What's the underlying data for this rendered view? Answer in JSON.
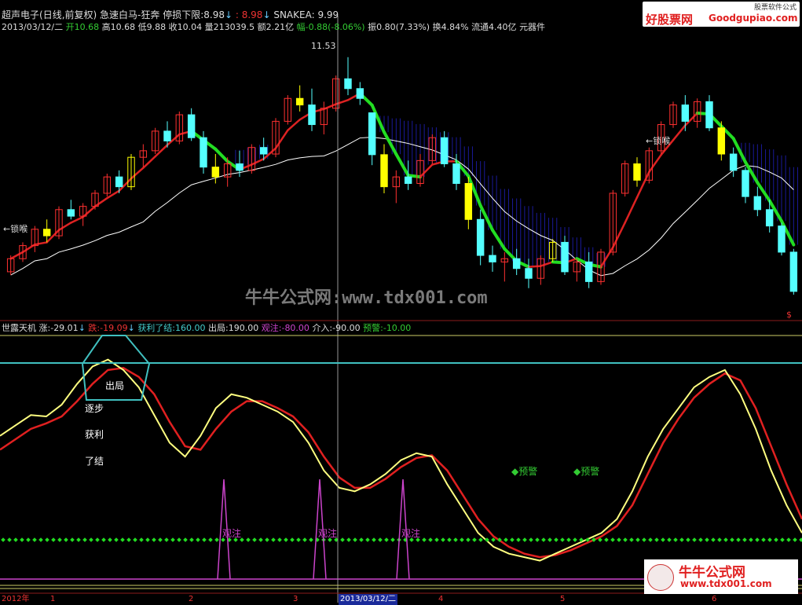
{
  "header": {
    "stock_name": "超声电子",
    "mode": "(日线,前复权)",
    "formula": "急速白马-狂奔",
    "stoploss_label": "停损下限:",
    "stoploss_value": "8.98",
    "stoploss_value2": ": 8.98",
    "snakea_label": "SNAKEA:",
    "snakea_value": "9.99",
    "date": "2013/03/12/二",
    "open": "开10.68",
    "high": "高10.68",
    "low": "低9.88",
    "close": "收10.04",
    "volume": "量213039.5",
    "amount": "额2.21亿",
    "change": "幅-0.88(-8.06%)",
    "amplitude": "振0.80(7.33%)",
    "turnover": "换4.84%",
    "float": "流通4.40亿",
    "sector": "元器件"
  },
  "logo": {
    "site_cn": "好股票网",
    "site_en": "Goodgupiao.com",
    "tag": "股票软件公式"
  },
  "watermark": {
    "center": "牛牛公式网:www.tdx001.com",
    "corner_cn": "牛牛公式网",
    "corner_url": "www.tdx001.com"
  },
  "indicator": {
    "name": "世露天机",
    "zhang_label": "涨:",
    "zhang_value": "-29.01",
    "die_label": "跌:",
    "die_value": "-19.09",
    "profit_label": "获利了结:",
    "profit_value": "160.00",
    "exit_label": "出局:",
    "exit_value": "190.00",
    "watch_label": "观注:",
    "watch_value": "-80.00",
    "enter_label": "介入:",
    "enter_value": "-90.00",
    "warn_label": "预警:",
    "warn_value": "-10.00"
  },
  "annotations": {
    "peak_price": "11.53",
    "lock_throat_left": "←锁喉",
    "lock_throat_right": "←锁喉",
    "exit": "出局",
    "gradual": "逐步",
    "profit": "获利",
    "close_out": "了结",
    "watch": "观注",
    "warning": "预警"
  },
  "xaxis": {
    "labels": [
      "2012年",
      "1",
      "2",
      "3",
      "2013/03/12/二",
      "4",
      "5",
      "6"
    ]
  },
  "colors": {
    "up_candle": "#ff3030",
    "down_candle": "#54ffff",
    "yellow": "#ffff00",
    "green_line": "#22dd22",
    "red_line": "#dd2222",
    "white_line": "#ffffff",
    "cloud": "#1a1a9a",
    "indicator_yellow": "#ffff80",
    "indicator_red": "#e02020",
    "magenta": "#cc44cc",
    "cyan": "#40c0c0"
  },
  "chart_data": {
    "type": "candlestick",
    "price_range": [
      7.6,
      11.9
    ],
    "candles": [
      {
        "o": 8.25,
        "h": 8.5,
        "l": 8.2,
        "c": 8.45
      },
      {
        "o": 8.45,
        "h": 8.7,
        "l": 8.4,
        "c": 8.65
      },
      {
        "o": 8.65,
        "h": 8.95,
        "l": 8.55,
        "c": 8.9
      },
      {
        "o": 8.9,
        "h": 9.05,
        "l": 8.7,
        "c": 8.8
      },
      {
        "o": 8.8,
        "h": 9.25,
        "l": 8.75,
        "c": 9.2
      },
      {
        "o": 9.2,
        "h": 9.35,
        "l": 9.05,
        "c": 9.1
      },
      {
        "o": 9.1,
        "h": 9.3,
        "l": 8.95,
        "c": 9.25
      },
      {
        "o": 9.25,
        "h": 9.5,
        "l": 9.2,
        "c": 9.45
      },
      {
        "o": 9.45,
        "h": 9.75,
        "l": 9.4,
        "c": 9.7
      },
      {
        "o": 9.7,
        "h": 9.8,
        "l": 9.45,
        "c": 9.55
      },
      {
        "o": 9.55,
        "h": 10.05,
        "l": 9.5,
        "c": 10.0
      },
      {
        "o": 10.0,
        "h": 10.2,
        "l": 9.85,
        "c": 10.1
      },
      {
        "o": 10.1,
        "h": 10.45,
        "l": 10.05,
        "c": 10.4
      },
      {
        "o": 10.4,
        "h": 10.55,
        "l": 10.15,
        "c": 10.25
      },
      {
        "o": 10.25,
        "h": 10.7,
        "l": 10.2,
        "c": 10.65
      },
      {
        "o": 10.65,
        "h": 10.75,
        "l": 10.25,
        "c": 10.3
      },
      {
        "o": 10.3,
        "h": 10.4,
        "l": 9.75,
        "c": 9.85
      },
      {
        "o": 9.85,
        "h": 10.05,
        "l": 9.6,
        "c": 9.7
      },
      {
        "o": 9.7,
        "h": 10.0,
        "l": 9.55,
        "c": 9.9
      },
      {
        "o": 9.9,
        "h": 10.1,
        "l": 9.7,
        "c": 9.8
      },
      {
        "o": 9.8,
        "h": 10.2,
        "l": 9.75,
        "c": 10.15
      },
      {
        "o": 10.15,
        "h": 10.3,
        "l": 9.95,
        "c": 10.05
      },
      {
        "o": 10.05,
        "h": 10.6,
        "l": 10.0,
        "c": 10.55
      },
      {
        "o": 10.55,
        "h": 10.95,
        "l": 10.5,
        "c": 10.9
      },
      {
        "o": 10.9,
        "h": 11.1,
        "l": 10.7,
        "c": 10.8
      },
      {
        "o": 10.8,
        "h": 11.05,
        "l": 10.4,
        "c": 10.5
      },
      {
        "o": 10.5,
        "h": 10.85,
        "l": 10.35,
        "c": 10.75
      },
      {
        "o": 10.75,
        "h": 11.25,
        "l": 10.7,
        "c": 11.2
      },
      {
        "o": 11.2,
        "h": 11.53,
        "l": 10.95,
        "c": 11.05
      },
      {
        "o": 11.05,
        "h": 11.15,
        "l": 10.8,
        "c": 10.9
      },
      {
        "o": 10.68,
        "h": 10.68,
        "l": 9.88,
        "c": 10.04
      },
      {
        "o": 10.04,
        "h": 10.2,
        "l": 9.45,
        "c": 9.55
      },
      {
        "o": 9.55,
        "h": 9.8,
        "l": 9.3,
        "c": 9.7
      },
      {
        "o": 9.7,
        "h": 9.95,
        "l": 9.5,
        "c": 9.6
      },
      {
        "o": 9.6,
        "h": 10.05,
        "l": 9.55,
        "c": 9.95
      },
      {
        "o": 9.95,
        "h": 10.35,
        "l": 9.9,
        "c": 10.3
      },
      {
        "o": 10.3,
        "h": 10.4,
        "l": 9.85,
        "c": 9.9
      },
      {
        "o": 9.9,
        "h": 10.05,
        "l": 9.5,
        "c": 9.6
      },
      {
        "o": 9.6,
        "h": 9.7,
        "l": 8.9,
        "c": 9.05
      },
      {
        "o": 9.05,
        "h": 9.2,
        "l": 8.35,
        "c": 8.5
      },
      {
        "o": 8.5,
        "h": 8.65,
        "l": 8.25,
        "c": 8.4
      },
      {
        "o": 8.4,
        "h": 8.55,
        "l": 8.1,
        "c": 8.45
      },
      {
        "o": 8.45,
        "h": 8.6,
        "l": 8.2,
        "c": 8.3
      },
      {
        "o": 8.3,
        "h": 8.45,
        "l": 8.0,
        "c": 8.15
      },
      {
        "o": 8.15,
        "h": 8.5,
        "l": 8.05,
        "c": 8.45
      },
      {
        "o": 8.45,
        "h": 8.75,
        "l": 8.4,
        "c": 8.7
      },
      {
        "o": 8.7,
        "h": 8.8,
        "l": 8.2,
        "c": 8.25
      },
      {
        "o": 8.25,
        "h": 8.45,
        "l": 8.1,
        "c": 8.4
      },
      {
        "o": 8.4,
        "h": 8.55,
        "l": 8.0,
        "c": 8.1
      },
      {
        "o": 8.1,
        "h": 8.6,
        "l": 8.05,
        "c": 8.55
      },
      {
        "o": 8.55,
        "h": 9.5,
        "l": 8.5,
        "c": 9.45
      },
      {
        "o": 9.45,
        "h": 9.95,
        "l": 9.4,
        "c": 9.9
      },
      {
        "o": 9.9,
        "h": 10.0,
        "l": 9.55,
        "c": 9.65
      },
      {
        "o": 9.65,
        "h": 10.15,
        "l": 9.6,
        "c": 10.1
      },
      {
        "o": 10.1,
        "h": 10.55,
        "l": 10.05,
        "c": 10.5
      },
      {
        "o": 10.5,
        "h": 10.85,
        "l": 10.45,
        "c": 10.8
      },
      {
        "o": 10.8,
        "h": 10.95,
        "l": 10.4,
        "c": 10.55
      },
      {
        "o": 10.55,
        "h": 10.9,
        "l": 10.45,
        "c": 10.85
      },
      {
        "o": 10.85,
        "h": 10.95,
        "l": 10.4,
        "c": 10.45
      },
      {
        "o": 10.45,
        "h": 10.55,
        "l": 9.95,
        "c": 10.05
      },
      {
        "o": 10.05,
        "h": 10.15,
        "l": 9.7,
        "c": 9.8
      },
      {
        "o": 9.8,
        "h": 9.85,
        "l": 9.3,
        "c": 9.4
      },
      {
        "o": 9.4,
        "h": 9.55,
        "l": 9.1,
        "c": 9.2
      },
      {
        "o": 9.2,
        "h": 9.35,
        "l": 8.85,
        "c": 8.95
      },
      {
        "o": 8.95,
        "h": 9.0,
        "l": 8.5,
        "c": 8.55
      },
      {
        "o": 8.55,
        "h": 8.6,
        "l": 7.9,
        "c": 7.95
      }
    ],
    "indicator_range": [
      -120,
      220
    ],
    "indicator_yellow": [
      90,
      105,
      120,
      118,
      135,
      165,
      190,
      200,
      185,
      160,
      120,
      80,
      60,
      90,
      130,
      150,
      145,
      135,
      125,
      110,
      80,
      40,
      15,
      10,
      20,
      35,
      55,
      65,
      60,
      20,
      -15,
      -50,
      -70,
      -80,
      -85,
      -90,
      -80,
      -70,
      -60,
      -50,
      -30,
      10,
      60,
      100,
      130,
      160,
      175,
      185,
      150,
      100,
      40,
      -10,
      -50
    ],
    "indicator_red": [
      70,
      85,
      100,
      108,
      118,
      140,
      165,
      185,
      188,
      175,
      150,
      110,
      75,
      70,
      100,
      125,
      140,
      140,
      130,
      118,
      95,
      60,
      30,
      15,
      15,
      28,
      45,
      58,
      62,
      40,
      5,
      -30,
      -55,
      -70,
      -80,
      -85,
      -82,
      -75,
      -65,
      -55,
      -40,
      -10,
      35,
      80,
      115,
      145,
      165,
      180,
      170,
      130,
      75,
      20,
      -30
    ],
    "watch_spikes_x": [
      285,
      407,
      513
    ],
    "dotted_level": -60
  }
}
